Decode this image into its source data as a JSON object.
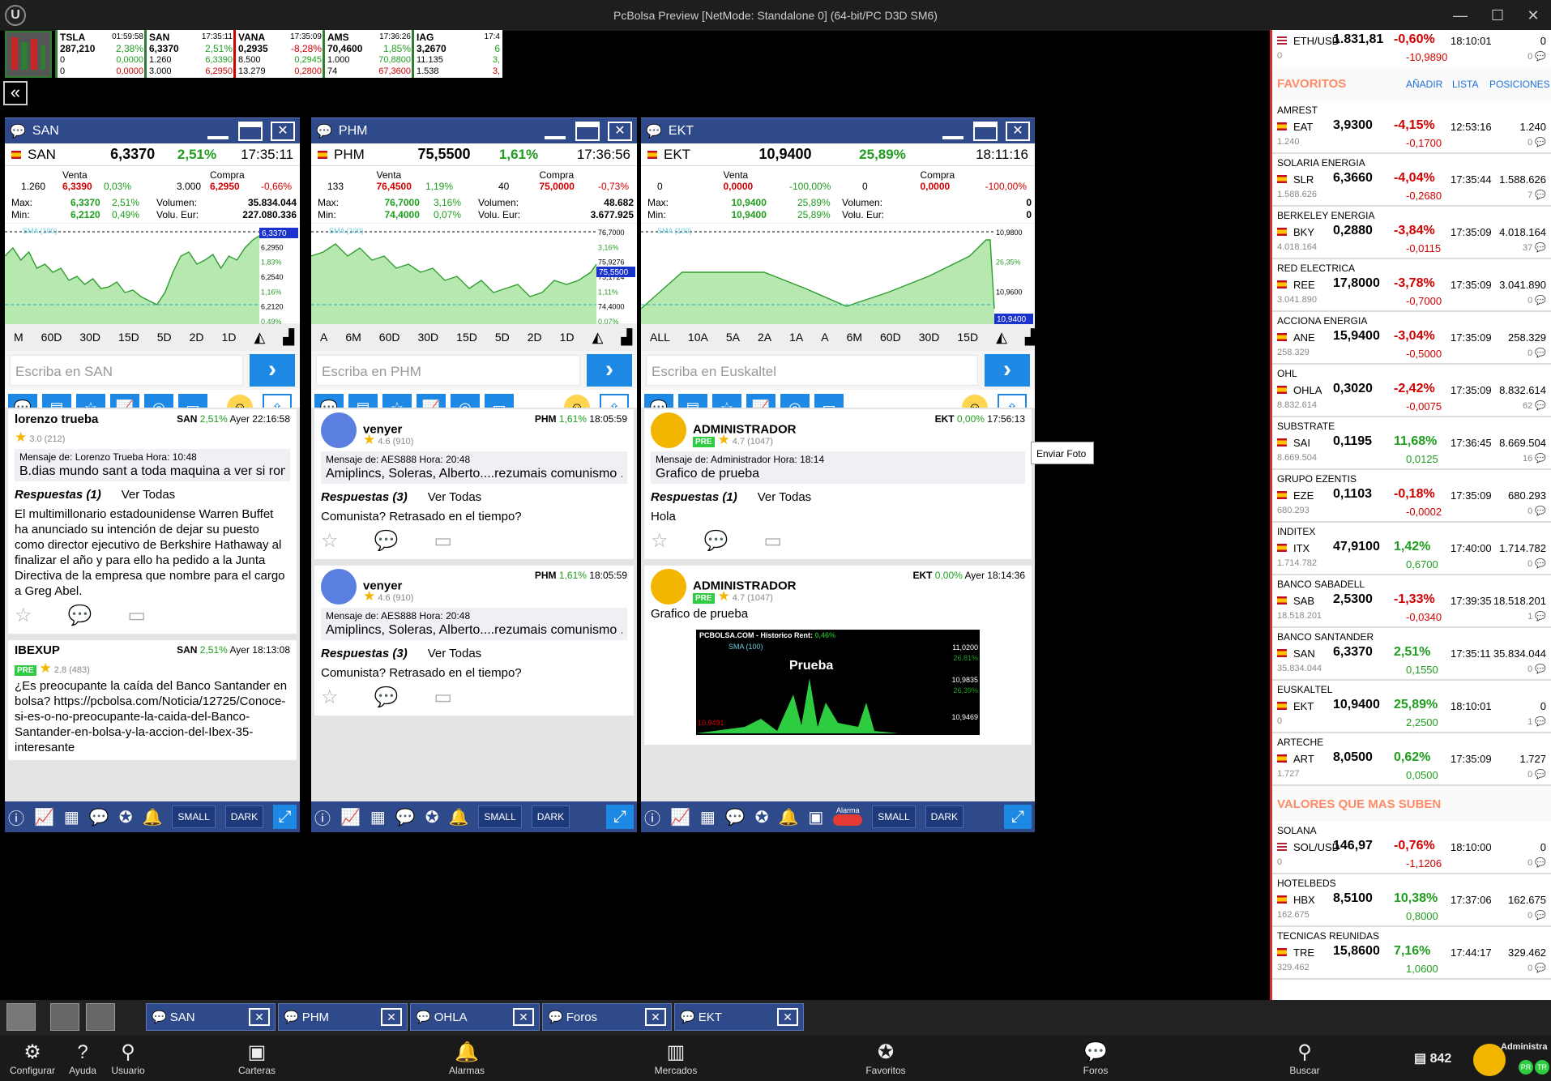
{
  "window": {
    "title": "PcBolsa Preview [NetMode: Standalone 0]  (64-bit/PC D3D SM6)",
    "min": "—",
    "max": "☐",
    "close": "✕"
  },
  "tickers": [
    {
      "sym": "TSLA",
      "time": "01:59:58",
      "price": "287,210",
      "pct": "2,38%",
      "l1a": "0",
      "l1b": "0,0000",
      "l2a": "0",
      "l2b": "0,0000"
    },
    {
      "sym": "SAN",
      "time": "17:35:11",
      "price": "6,3370",
      "pct": "2,51%",
      "l1a": "1.260",
      "l1b": "6,3390",
      "l2a": "3.000",
      "l2b": "6,2950"
    },
    {
      "sym": "VANA",
      "time": "17:35:09",
      "price": "0,2935",
      "pct": "-8,28%",
      "l1a": "8.500",
      "l1b": "0,2945",
      "l2a": "13.279",
      "l2b": "0,2800"
    },
    {
      "sym": "AMS",
      "time": "17:36:26",
      "price": "70,4600",
      "pct": "1,85%",
      "l1a": "1.000",
      "l1b": "70,8800",
      "l2a": "74",
      "l2b": "67,3600"
    },
    {
      "sym": "IAG",
      "time": "17:4",
      "price": "3,2670",
      "pct": "6",
      "l1a": "11.135",
      "l1b": "3,",
      "l2a": "1.538",
      "l2b": "3,"
    }
  ],
  "collapse_icon": "«",
  "panels": [
    {
      "name": "SAN",
      "sym": "SAN",
      "price": "6,3370",
      "pct": "2,51%",
      "time": "17:35:11",
      "venta_lbl": "Venta",
      "compra_lbl": "Compra",
      "v_qty": "1.260",
      "v_price": "6,3390",
      "v_pct": "0,03%",
      "c_qty": "3.000",
      "c_price": "6,2950",
      "c_pct": "-0,66%",
      "max_lbl": "Max:",
      "min_lbl": "Min:",
      "max": "6,3370",
      "max_pct": "2,51%",
      "min": "6,2120",
      "min_pct": "0,49%",
      "vol_lbl": "Volumen:",
      "voleur_lbl": "Volu. Eur:",
      "vol": "35.834.044",
      "voleur": "227.080.336",
      "axis": [
        "6,3370",
        "6,2950",
        "1,83%",
        "6,2540",
        "1,16%",
        "6,2120",
        "0,49%"
      ],
      "current": "6,3370",
      "sma": "SMA (100)",
      "periods": [
        "M",
        "60D",
        "30D",
        "15D",
        "5D",
        "2D",
        "1D"
      ],
      "placeholder": "Escriba en SAN"
    },
    {
      "name": "PHM",
      "sym": "PHM",
      "price": "75,5500",
      "pct": "1,61%",
      "time": "17:36:56",
      "venta_lbl": "Venta",
      "compra_lbl": "Compra",
      "v_qty": "133",
      "v_price": "76,4500",
      "v_pct": "1,19%",
      "c_qty": "40",
      "c_price": "75,0000",
      "c_pct": "-0,73%",
      "max_lbl": "Max:",
      "min_lbl": "Min:",
      "max": "76,7000",
      "max_pct": "3,16%",
      "min": "74,4000",
      "min_pct": "0,07%",
      "vol_lbl": "Volumen:",
      "voleur_lbl": "Volu. Eur:",
      "vol": "48.682",
      "voleur": "3.677.925",
      "axis": [
        "76,7000",
        "3,16%",
        "75,9276",
        "75,1724",
        "1,11%",
        "74,4000",
        "0,07%"
      ],
      "current": "75,5500",
      "sma": "SMA (100)",
      "periods": [
        "A",
        "6M",
        "60D",
        "30D",
        "15D",
        "5D",
        "2D",
        "1D"
      ],
      "placeholder": "Escriba en PHM"
    },
    {
      "name": "EKT",
      "sym": "EKT",
      "price": "10,9400",
      "pct": "25,89%",
      "time": "18:11:16",
      "venta_lbl": "Venta",
      "compra_lbl": "Compra",
      "v_qty": "0",
      "v_price": "0,0000",
      "v_pct": "-100,00%",
      "c_qty": "0",
      "c_price": "0,0000",
      "c_pct": "-100,00%",
      "max_lbl": "Max:",
      "min_lbl": "Min:",
      "max": "10,9400",
      "max_pct": "25,89%",
      "min": "10,9400",
      "min_pct": "25,89%",
      "vol_lbl": "Volumen:",
      "voleur_lbl": "Volu. Eur:",
      "vol": "0",
      "voleur": "0",
      "axis": [
        "10,9800",
        "26,35%",
        "10,9600",
        "26,12%"
      ],
      "current": "10,9400",
      "sma": "SMA (100)",
      "periods": [
        "ALL",
        "10A",
        "5A",
        "2A",
        "1A",
        "A",
        "6M",
        "60D",
        "30D",
        "15D"
      ],
      "placeholder": "Escriba en Euskaltel"
    }
  ],
  "posts": {
    "san1": {
      "author": "lorenzo trueba",
      "sym": "SAN",
      "pct": "2,51%",
      "when": "Ayer 22:16:58",
      "rating": "3.0",
      "votes": "(212)",
      "msg_from": "Mensaje de: Lorenzo Trueba  Hora: 10:48",
      "msg": "B.dias mundo sant a toda maquina a ver si rom",
      "resp": "Respuestas (1)",
      "ver": "Ver Todas",
      "body": "El multimillonario estadounidense Warren Buffet ha anunciado su intención de dejar su puesto como director ejecutivo de Berkshire Hathaway al finalizar el año y para ello ha pedido a la Junta Directiva de la empresa que nombre para el cargo a Greg Abel."
    },
    "san2": {
      "author": "IBEXUP",
      "sym": "SAN",
      "pct": "2,51%",
      "when": "Ayer 18:13:08",
      "pre": "PRE",
      "rating": "2.8",
      "votes": "(483)",
      "body": "¿Es preocupante la caída del Banco Santander en bolsa? https://pcbolsa.com/Noticia/12725/Conoce-si-es-o-no-preocupante-la-caida-del-Banco-Santander-en-bolsa-y-la-accion-del-Ibex-35-interesante"
    },
    "phm1": {
      "author": "venyer",
      "sym": "PHM",
      "pct": "1,61%",
      "when": "18:05:59",
      "rating": "4.6",
      "votes": "(910)",
      "msg_from": "Mensaje de: AES888  Hora: 20:48",
      "msg": "Amiplincs, Soleras, Alberto....rezumais comunismo ..",
      "resp": "Respuestas (3)",
      "ver": "Ver Todas",
      "body": "Comunista? Retrasado en el tiempo?"
    },
    "phm2": {
      "author": "venyer",
      "sym": "PHM",
      "pct": "1,61%",
      "when": "18:05:59",
      "rating": "4.6",
      "votes": "(910)",
      "msg_from": "Mensaje de: AES888  Hora: 20:48",
      "msg": "Amiplincs, Soleras, Alberto....rezumais comunismo ..",
      "resp": "Respuestas (3)",
      "ver": "Ver Todas",
      "body": "Comunista? Retrasado en el tiempo?"
    },
    "ekt1": {
      "author": "ADMINISTRADOR",
      "sym": "EKT",
      "pct": "0,00%",
      "when": "17:56:13",
      "pre": "PRE",
      "rating": "4.7",
      "votes": "(1047)",
      "msg_from": "Mensaje de: Administrador  Hora: 18:14",
      "msg": "Grafico de prueba",
      "resp": "Respuestas (1)",
      "ver": "Ver Todas",
      "body": "Hola"
    },
    "ekt2": {
      "author": "ADMINISTRADOR",
      "sym": "EKT",
      "pct": "0,00%",
      "when": "Ayer 18:14:36",
      "pre": "PRE",
      "rating": "4.7",
      "votes": "(1047)",
      "body": "Grafico de prueba",
      "img_title": "PCBOLSA.COM - Historico Rent:",
      "img_pct": "0,46%",
      "img_sma": "SMA (100)",
      "img_label": "Prueba",
      "img_axis": [
        "11,0200",
        "26,81%",
        "10,9835",
        "26,39%",
        "10,9469"
      ],
      "img_left": "10,9491"
    }
  },
  "tooltip": "Enviar Foto",
  "bbar": {
    "small": "SMALL",
    "dark": "DARK",
    "alarma": "Alarma"
  },
  "right": {
    "eth": {
      "sym": "ETH/USD",
      "price": "1.831,81",
      "pct": "-0,60%",
      "time": "18:10:01",
      "vol": "0",
      "sub": "0",
      "chg": "-10,9890",
      "cnt": "0"
    },
    "fav_title": "FAVORITOS",
    "add": "AÑADIR",
    "list": "LISTA",
    "pos": "POSICIONES",
    "favs": [
      {
        "name": "AMREST",
        "sym": "EAT",
        "price": "3,9300",
        "pct": "-4,15%",
        "time": "12:53:16",
        "vol": "1.240",
        "sub": "1.240",
        "chg": "-0,1700",
        "cnt": "0"
      },
      {
        "name": "SOLARIA ENERGIA",
        "sym": "SLR",
        "price": "6,3660",
        "pct": "-4,04%",
        "time": "17:35:44",
        "vol": "1.588.626",
        "sub": "1.588.626",
        "chg": "-0,2680",
        "cnt": "7"
      },
      {
        "name": "BERKELEY ENERGIA",
        "sym": "BKY",
        "price": "0,2880",
        "pct": "-3,84%",
        "time": "17:35:09",
        "vol": "4.018.164",
        "sub": "4.018.164",
        "chg": "-0,0115",
        "cnt": "37"
      },
      {
        "name": "RED ELECTRICA",
        "sym": "REE",
        "price": "17,8000",
        "pct": "-3,78%",
        "time": "17:35:09",
        "vol": "3.041.890",
        "sub": "3.041.890",
        "chg": "-0,7000",
        "cnt": "0"
      },
      {
        "name": "ACCIONA ENERGIA",
        "sym": "ANE",
        "price": "15,9400",
        "pct": "-3,04%",
        "time": "17:35:09",
        "vol": "258.329",
        "sub": "258.329",
        "chg": "-0,5000",
        "cnt": "0"
      },
      {
        "name": "OHL",
        "sym": "OHLA",
        "price": "0,3020",
        "pct": "-2,42%",
        "time": "17:35:09",
        "vol": "8.832.614",
        "sub": "8.832.614",
        "chg": "-0,0075",
        "cnt": "62"
      },
      {
        "name": "SUBSTRATE",
        "sym": "SAI",
        "price": "0,1195",
        "pct": "11,68%",
        "time": "17:36:45",
        "vol": "8.669.504",
        "sub": "8.669.504",
        "chg": "0,0125",
        "cnt": "16"
      },
      {
        "name": "GRUPO EZENTIS",
        "sym": "EZE",
        "price": "0,1103",
        "pct": "-0,18%",
        "time": "17:35:09",
        "vol": "680.293",
        "sub": "680.293",
        "chg": "-0,0002",
        "cnt": "0"
      },
      {
        "name": "INDITEX",
        "sym": "ITX",
        "price": "47,9100",
        "pct": "1,42%",
        "time": "17:40:00",
        "vol": "1.714.782",
        "sub": "1.714.782",
        "chg": "0,6700",
        "cnt": "0"
      },
      {
        "name": "BANCO SABADELL",
        "sym": "SAB",
        "price": "2,5300",
        "pct": "-1,33%",
        "time": "17:39:35",
        "vol": "18.518.201",
        "sub": "18.518.201",
        "chg": "-0,0340",
        "cnt": "1"
      },
      {
        "name": "BANCO SANTANDER",
        "sym": "SAN",
        "price": "6,3370",
        "pct": "2,51%",
        "time": "17:35:11",
        "vol": "35.834.044",
        "sub": "35.834.044",
        "chg": "0,1550",
        "cnt": "0"
      },
      {
        "name": "EUSKALTEL",
        "sym": "EKT",
        "price": "10,9400",
        "pct": "25,89%",
        "time": "18:10:01",
        "vol": "0",
        "sub": "0",
        "chg": "2,2500",
        "cnt": "1"
      },
      {
        "name": "ARTECHE",
        "sym": "ART",
        "price": "8,0500",
        "pct": "0,62%",
        "time": "17:35:09",
        "vol": "1.727",
        "sub": "1.727",
        "chg": "0,0500",
        "cnt": "0"
      }
    ],
    "up_title": "VALORES QUE MAS SUBEN",
    "ups": [
      {
        "name": "SOLANA",
        "sym": "SOL/USD",
        "price": "146,97",
        "pct": "-0,76%",
        "time": "18:10:00",
        "vol": "0",
        "sub": "0",
        "chg": "-1,1206",
        "cnt": "0"
      },
      {
        "name": "HOTELBEDS",
        "sym": "HBX",
        "price": "8,5100",
        "pct": "10,38%",
        "time": "17:37:06",
        "vol": "162.675",
        "sub": "162.675",
        "chg": "0,8000",
        "cnt": "0"
      },
      {
        "name": "TECNICAS REUNIDAS",
        "sym": "TRE",
        "price": "15,8600",
        "pct": "7,16%",
        "time": "17:44:17",
        "vol": "329.462",
        "sub": "329.462",
        "chg": "1,0600",
        "cnt": "0"
      }
    ]
  },
  "tabs": [
    "SAN",
    "PHM",
    "OHLA",
    "Foros",
    "EKT"
  ],
  "bottom": {
    "items": [
      "Configurar",
      "Ayuda",
      "Usuario",
      "Carteras",
      "Alarmas",
      "Mercados",
      "Favoritos",
      "Foros",
      "Buscar"
    ],
    "balance": "842",
    "user": "Administra",
    "badge1": "PR",
    "badge2": "TR"
  }
}
